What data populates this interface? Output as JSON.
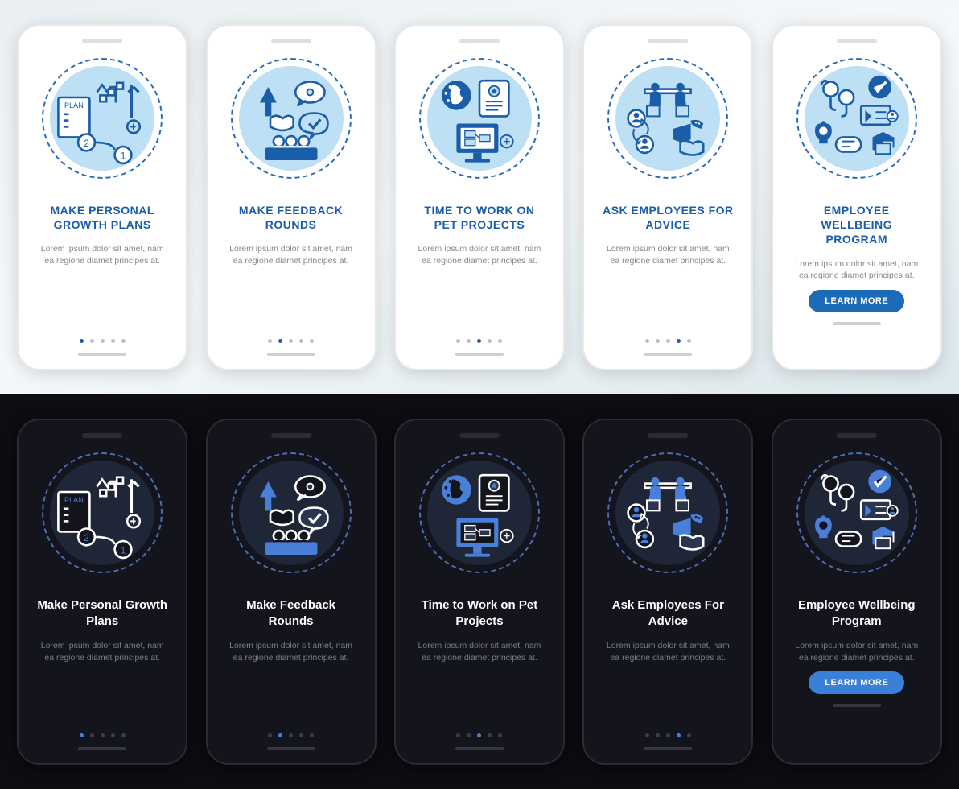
{
  "lorem": "Lorem ipsum dolor sit amet, nam ea regione diamet principes at.",
  "cta_label": "LEARN MORE",
  "light_cards": [
    {
      "title": "MAKE PERSONAL GROWTH PLANS",
      "active": 0
    },
    {
      "title": "MAKE FEEDBACK ROUNDS",
      "active": 1
    },
    {
      "title": "TIME TO WORK ON PET PROJECTS",
      "active": 2
    },
    {
      "title": "ASK EMPLOYEES FOR ADVICE",
      "active": 3
    },
    {
      "title": "EMPLOYEE WELLBEING PROGRAM",
      "active": 4,
      "cta": true
    }
  ],
  "dark_cards": [
    {
      "title": "Make Personal Growth Plans",
      "active": 0
    },
    {
      "title": "Make Feedback Rounds",
      "active": 1
    },
    {
      "title": "Time to Work on Pet Projects",
      "active": 2
    },
    {
      "title": "Ask Employees For Advice",
      "active": 3
    },
    {
      "title": "Employee Wellbeing Program",
      "active": 4,
      "cta": true
    }
  ],
  "colors": {
    "primary_light": "#1a5da8",
    "primary_dark": "#4a7fd8",
    "bg_dark": "#14151c"
  }
}
